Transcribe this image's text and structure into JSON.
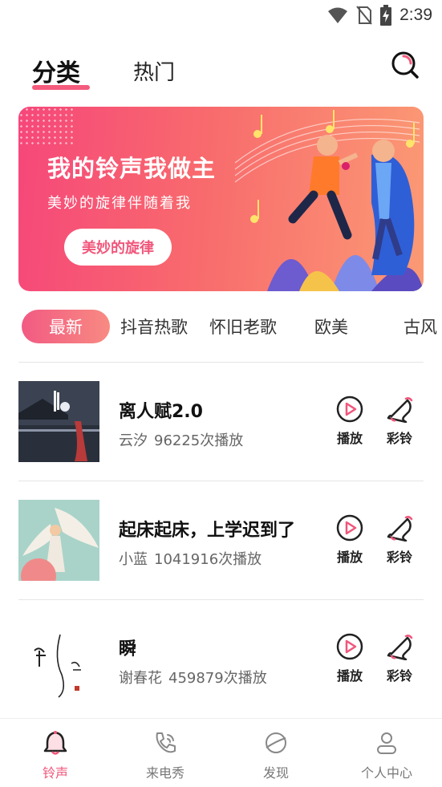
{
  "status_bar": {
    "time": "2:39",
    "icons": [
      "wifi-icon",
      "no-sim-icon",
      "battery-charging-icon"
    ]
  },
  "header": {
    "tabs": [
      {
        "label": "分类",
        "active": true
      },
      {
        "label": "热门",
        "active": false
      }
    ],
    "search_icon": "search-icon"
  },
  "banner": {
    "title": "我的铃声我做主",
    "subtitle": "美妙的旋律伴随着我",
    "button_label": "美妙的旋律",
    "gradient": [
      "#f6477a",
      "#fb9a74"
    ]
  },
  "categories": {
    "items": [
      "最新",
      "抖音热歌",
      "怀旧老歌",
      "欧美",
      "古风"
    ],
    "active": "最新"
  },
  "songs": [
    {
      "title": "离人赋2.0",
      "artist": "云汐",
      "plays": "96225次播放",
      "play_label": "播放",
      "ring_label": "彩铃"
    },
    {
      "title": "起床起床，上学迟到了",
      "artist": "小蓝",
      "plays": "1041916次播放",
      "play_label": "播放",
      "ring_label": "彩铃"
    },
    {
      "title": "瞬",
      "artist": "谢春花",
      "plays": "459879次播放",
      "play_label": "播放",
      "ring_label": "彩铃"
    }
  ],
  "bottom_nav": {
    "items": [
      {
        "label": "铃声",
        "icon": "bell-icon",
        "active": true
      },
      {
        "label": "来电秀",
        "icon": "phone-icon",
        "active": false
      },
      {
        "label": "发现",
        "icon": "planet-icon",
        "active": false
      },
      {
        "label": "个人中心",
        "icon": "user-icon",
        "active": false
      }
    ]
  },
  "colors": {
    "accent": "#f1567b",
    "text": "#222222",
    "muted": "#666666"
  }
}
